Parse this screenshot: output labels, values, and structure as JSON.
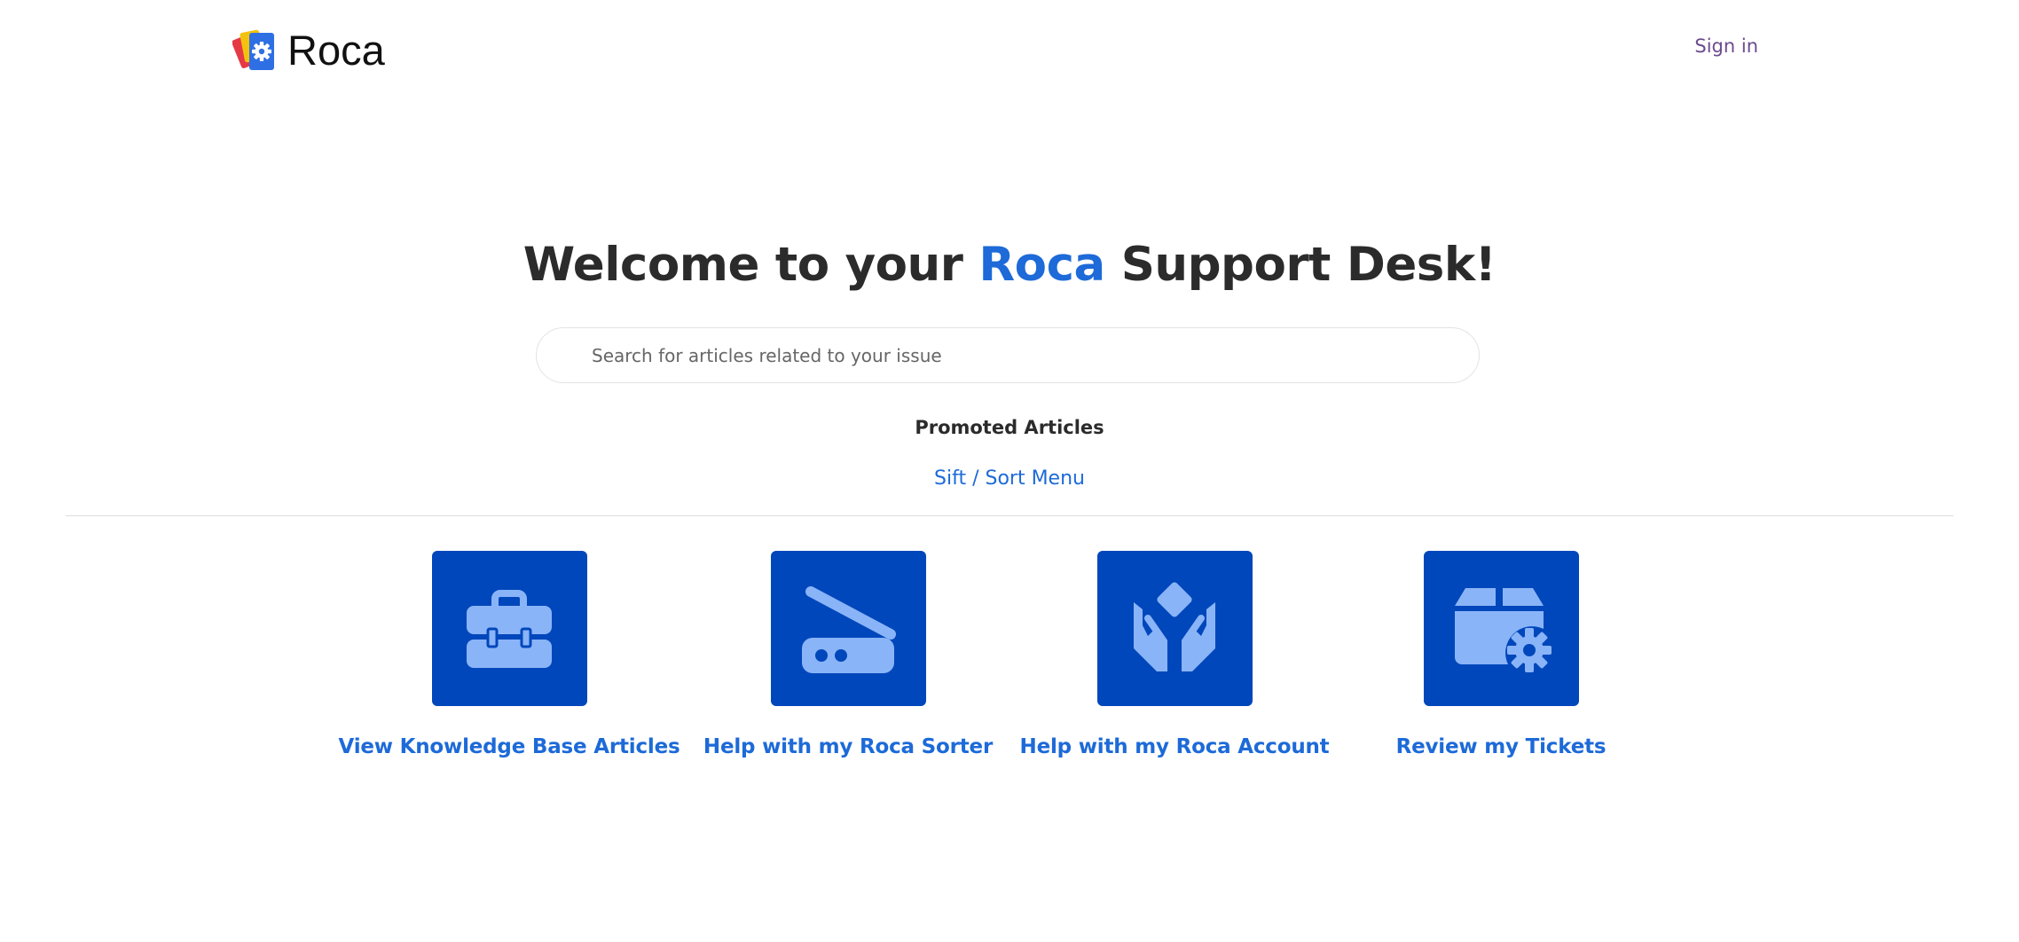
{
  "header": {
    "logo_text": "Roca",
    "logo_icon": "roca-cards-gear-icon",
    "signin_label": "Sign in"
  },
  "hero": {
    "title_prefix": "Welcome to your ",
    "title_brand": "Roca",
    "title_suffix": " Support Desk!",
    "brand_color": "#1d6ad8"
  },
  "search": {
    "placeholder": "Search for articles related to your issue",
    "value": ""
  },
  "promoted": {
    "heading": "Promoted Articles",
    "links": [
      "Sift / Sort Menu"
    ]
  },
  "tiles": [
    {
      "label": "View Knowledge Base Articles",
      "icon": "toolbox-icon"
    },
    {
      "label": "Help with my Roca Sorter",
      "icon": "scanner-icon"
    },
    {
      "label": "Help with my Roca Account",
      "icon": "hands-holding-diamond-icon"
    },
    {
      "label": "Review my Tickets",
      "icon": "box-gear-icon"
    }
  ],
  "colors": {
    "tile_background": "#0047bb",
    "tile_icon": "#8ab4f8",
    "link": "#1d6ad8",
    "signin": "#6c4a8f",
    "heading_text": "#2b2b2b"
  }
}
